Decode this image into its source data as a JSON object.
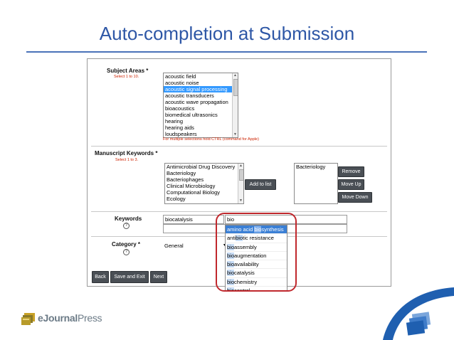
{
  "slide": {
    "title": "Auto-completion at Submission",
    "accent_color": "#2e57a6",
    "brand_name_bold": "eJournal",
    "brand_name_rest": "Press"
  },
  "subject_areas": {
    "label": "Subject Areas",
    "required_mark": "*",
    "hint": "Select 1 to 10.",
    "options": [
      "acoustic field",
      "acoustic noise",
      "acoustic signal processing",
      "acoustic transducers",
      "acoustic wave propagation",
      "bioacoustics",
      "biomedical ultrasonics",
      "hearing",
      "hearing aids",
      "loudspeakers"
    ],
    "selected": "acoustic signal processing",
    "note": "For multiple selections hold CTRL (command for Apple)"
  },
  "manuscript_keywords": {
    "label": "Manuscript Keywords",
    "required_mark": "*",
    "hint": "Select 1 to 3.",
    "options": [
      "Antimicrobial Drug Discovery",
      "Bacteriology",
      "Bacteriophages",
      "Clinical Microbiology",
      "Computational Biology",
      "Ecology"
    ],
    "add_button": "Add to list",
    "chosen": [
      "Bacteriology"
    ],
    "remove_button": "Remove",
    "move_up_button": "Move Up",
    "move_down_button": "Move Down"
  },
  "keywords": {
    "label": "Keywords",
    "help_glyph": "?",
    "values": [
      "biocatalysis",
      "bio",
      ""
    ],
    "suggestions": [
      {
        "pre": "amino acid ",
        "hit": "bio",
        "post": "synthesis"
      },
      {
        "pre": "anti",
        "hit": "bio",
        "post": "tic resistance"
      },
      {
        "pre": "",
        "hit": "bio",
        "post": "assembly"
      },
      {
        "pre": "",
        "hit": "bio",
        "post": "augmentation"
      },
      {
        "pre": "",
        "hit": "bio",
        "post": "availability"
      },
      {
        "pre": "",
        "hit": "bio",
        "post": "catalysis"
      },
      {
        "pre": "",
        "hit": "bio",
        "post": "chemistry"
      },
      {
        "pre": "",
        "hit": "bio",
        "post": "control"
      }
    ]
  },
  "category": {
    "label": "Category",
    "required_mark": "*",
    "help_glyph": "?",
    "value": "General",
    "arrow": "▾"
  },
  "footer_buttons": {
    "back": "Back",
    "save_exit": "Save and Exit",
    "next": "Next"
  },
  "scroll_glyphs": {
    "up": "▲",
    "down": "▼"
  }
}
